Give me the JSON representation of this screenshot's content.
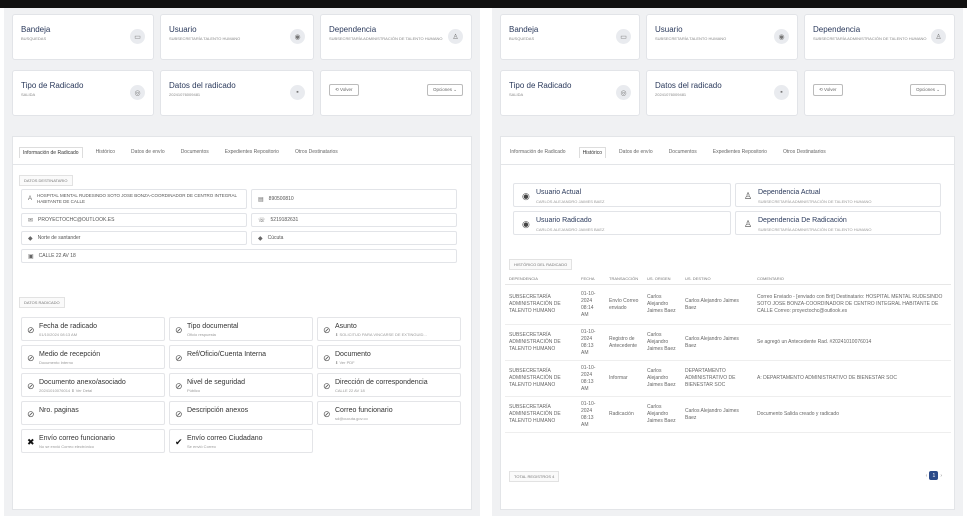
{
  "left": {
    "cards": [
      {
        "title": "Bandeja",
        "sub": "Busquedas",
        "icon": "▭"
      },
      {
        "title": "Usuario",
        "sub": "SUBSECRETARÍA TALENTO HUMANO",
        "icon": "◉"
      },
      {
        "title": "Dependencia",
        "sub": "SUBSECRETARÍA ADMINISTRACIÓN DE TALENTO HUMANO",
        "icon": "♙"
      },
      {
        "title": "Tipo de Radicado",
        "sub": "SALIDA",
        "icon": "◎"
      },
      {
        "title": "Datos del radicado",
        "sub": "20241076009481",
        "icon": "▪"
      }
    ],
    "volver": "⟲ Volver",
    "opciones": "Opciones ⌄",
    "tabs": [
      "Información de Radicado",
      "Histórico",
      "Datos de envío",
      "Documentos",
      "Expedientes Repositorio",
      "Otros Destinatarios"
    ],
    "dest_label": "DATOS DESTINATARIO",
    "dest_name": "HOSPITAL MENTAL RUDESINDO SOTO JOSE BONZA-COORDINADOR DE CENTRO INTEGRAL HABITANTE DE CALLE",
    "dest_id": "890500810",
    "email": "PROYECTOCHC@OUTLOOK.ES",
    "phone": "5219182631",
    "dept": "Norte de santander",
    "city": "Cúcuta",
    "address": "CALLE 22 AV 18",
    "rad_label": "DATOS RADICADO",
    "details": [
      {
        "title": "Fecha de radicado",
        "sub": "01/10/2024 08:13 AM",
        "icon": "⊘"
      },
      {
        "title": "Tipo documental",
        "sub": "Oficio respuesta",
        "icon": "⊘"
      },
      {
        "title": "Asunto",
        "sub": "⬇ SOLICITUD PARA VINCARSE DE EXTINGUID...",
        "icon": "⊘"
      },
      {
        "title": "Medio de recepción",
        "sub": "Documento Interno",
        "icon": "⊘"
      },
      {
        "title": "Ref/Oficio/Cuenta Interna",
        "sub": "",
        "icon": "⊘"
      },
      {
        "title": "Documento",
        "sub": "⬇ Ver PDF",
        "icon": "⊘"
      },
      {
        "title": "Documento anexo/asociado",
        "sub": "20241010076014  ⬇ Ver Detal",
        "icon": "⊘"
      },
      {
        "title": "Nivel de seguridad",
        "sub": "Público",
        "icon": "⊘"
      },
      {
        "title": "Dirección de correspondencia",
        "sub": "CALLE 22 AV 18",
        "icon": "⊘"
      },
      {
        "title": "Nro. paginas",
        "sub": "",
        "icon": "⊘"
      },
      {
        "title": "Descripción anexos",
        "sub": "",
        "icon": "⊘"
      },
      {
        "title": "Correo funcionario",
        "sub": "sd@cucuta.gov.co",
        "icon": "⊘"
      },
      {
        "title": "Envío correo funcionario",
        "sub": "No se envió Correo electrónico",
        "icon": "✖"
      },
      {
        "title": "Envío correo Ciudadano",
        "sub": "Se envió Correo",
        "icon": "✔"
      }
    ]
  },
  "right": {
    "cards": [
      {
        "title": "Bandeja",
        "sub": "Busquedas",
        "icon": "▭"
      },
      {
        "title": "Usuario",
        "sub": "SUBSECRETARÍA TALENTO HUMANO",
        "icon": "◉"
      },
      {
        "title": "Dependencia",
        "sub": "SUBSECRETARÍA ADMINISTRACIÓN DE TALENTO HUMANO",
        "icon": "♙"
      },
      {
        "title": "Tipo de Radicado",
        "sub": "SALIDA",
        "icon": "◎"
      },
      {
        "title": "Datos del radicado",
        "sub": "20241076009481",
        "icon": "▪"
      }
    ],
    "volver": "⟲ Volver",
    "opciones": "Opciones ⌄",
    "tabs": [
      "Información de Radicado",
      "Histórico",
      "Datos de envío",
      "Documentos",
      "Expedientes Repositorio",
      "Otros Destinatarios"
    ],
    "hboxes": [
      {
        "title": "Usuario Actual",
        "sub": "Carlos Alejandro Jaimes Baez",
        "icon": "◉"
      },
      {
        "title": "Dependencia Actual",
        "sub": "SUBSECRETARÍA ADMINISTRACIÓN DE TALENTO HUMANO",
        "icon": "♙"
      },
      {
        "title": "Usuario Radicado",
        "sub": "Carlos Alejandro Jaimes Baez",
        "icon": "◉"
      },
      {
        "title": "Dependencia De Radicación",
        "sub": "SUBSECRETARÍA ADMINISTRACIÓN DE TALENTO HUMANO",
        "icon": "♙"
      }
    ],
    "hist_label": "HISTÓRICO DEL RADICADO",
    "headers": [
      "DEPENDENCIA",
      "FECHA",
      "TRANSACCIÓN",
      "US. ORIGEN",
      "US. DESTINO",
      "COMENTARIO"
    ],
    "rows": [
      [
        "SUBSECRETARÍA ADMINISTRACIÓN DE TALENTO HUMANO",
        "01-10-2024 08:14 AM",
        "Envío Correo enviado",
        "Carlos Alejandro Jaimes Baez",
        "Carlos Alejandro Jaimes Baez",
        "Correo Enviado - [enviado con Brit] Destinatario: HOSPITAL MENTAL RUDESINDO SOTO JOSE BONZA-COORDINADOR DE CENTRO INTEGRAL HABITANTE DE CALLE Correo: proyectochc@outlook.es"
      ],
      [
        "SUBSECRETARÍA ADMINISTRACIÓN DE TALENTO HUMANO",
        "01-10-2024 08:13 AM",
        "Registro de Antecedente",
        "Carlos Alejandro Jaimes Baez",
        "Carlos Alejandro Jaimes Baez",
        "Se agregó un Antecedente Rad. #20241010076014"
      ],
      [
        "SUBSECRETARÍA ADMINISTRACIÓN DE TALENTO HUMANO",
        "01-10-2024 08:13 AM",
        "Informar",
        "Carlos Alejandro Jaimes Baez",
        "DEPARTAMENTO ADMINISTRATIVO DE BIENESTAR SOC",
        "A: DEPARTAMENTO ADMINISTRATIVO DE BIENESTAR SOC"
      ],
      [
        "SUBSECRETARÍA ADMINISTRACIÓN DE TALENTO HUMANO",
        "01-10-2024 08:13 AM",
        "Radicación",
        "Carlos Alejandro Jaimes Baez",
        "Carlos Alejandro Jaimes Baez",
        "Documento Salida creado y radicado"
      ]
    ],
    "total": "TOTAL REGISTROS 4",
    "page": "1"
  }
}
